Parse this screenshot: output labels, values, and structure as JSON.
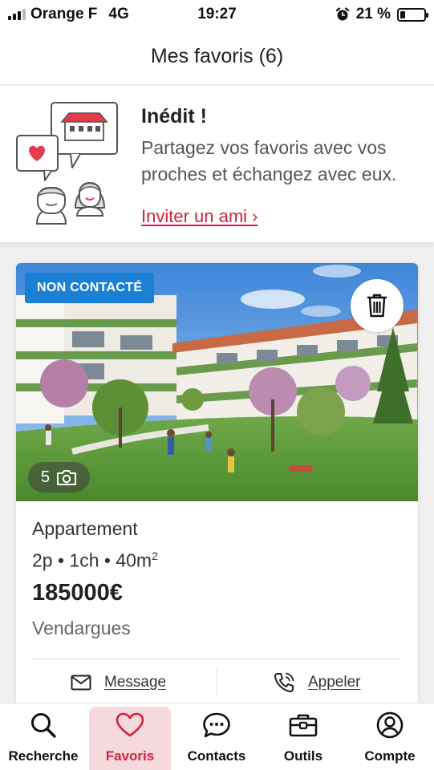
{
  "status_bar": {
    "carrier": "Orange F",
    "network": "4G",
    "time": "19:27",
    "battery_percent": "21 %",
    "battery_level": 0.21
  },
  "header": {
    "title": "Mes favoris (6)"
  },
  "promo": {
    "title": "Inédit !",
    "description": "Partagez vos favoris avec vos proches et échangez avec eux.",
    "link": "Inviter un ami ›"
  },
  "listing": {
    "badge": "NON CONTACTÉ",
    "photo_count": "5",
    "type": "Appartement",
    "details": "2p • 1ch • 40m",
    "details_sup": "2",
    "price": "185000€",
    "city": "Vendargues",
    "actions": {
      "message": "Message",
      "call": "Appeler"
    }
  },
  "nav": {
    "items": [
      {
        "label": "Recherche",
        "icon": "search-icon"
      },
      {
        "label": "Favoris",
        "icon": "heart-icon",
        "active": true
      },
      {
        "label": "Contacts",
        "icon": "chat-icon"
      },
      {
        "label": "Outils",
        "icon": "toolbox-icon"
      },
      {
        "label": "Compte",
        "icon": "account-icon"
      }
    ]
  },
  "colors": {
    "accent": "#d3213d",
    "badge": "#1a80d6",
    "active_tab_bg": "#f6d9dd"
  }
}
